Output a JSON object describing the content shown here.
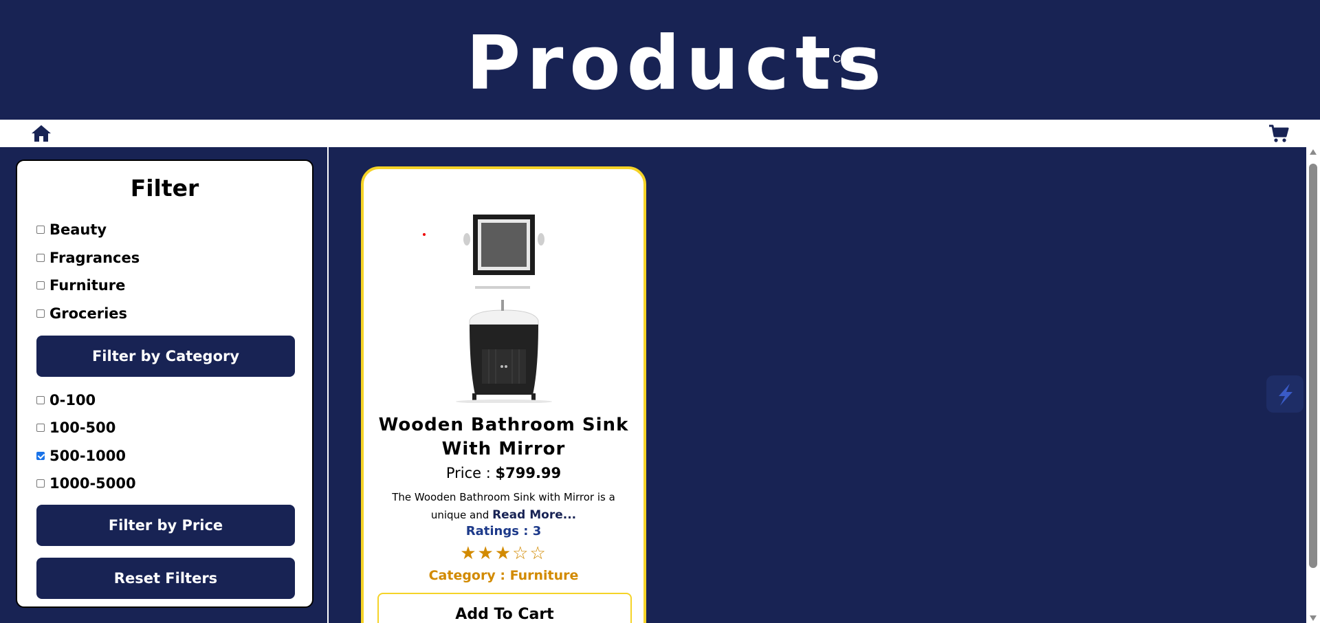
{
  "header": {
    "title": "Products",
    "cart_label": "Cart"
  },
  "navbar": {
    "home_icon": "home-icon",
    "cart_icon": "shopping-cart-icon"
  },
  "filter": {
    "title": "Filter",
    "categories": [
      {
        "label": "Beauty",
        "checked": false
      },
      {
        "label": "Fragrances",
        "checked": false
      },
      {
        "label": "Furniture",
        "checked": false
      },
      {
        "label": "Groceries",
        "checked": false
      }
    ],
    "category_button": "Filter by Category",
    "prices": [
      {
        "label": "0-100",
        "checked": false
      },
      {
        "label": "100-500",
        "checked": false
      },
      {
        "label": "500-1000",
        "checked": true
      },
      {
        "label": "1000-5000",
        "checked": false
      }
    ],
    "price_button": "Filter by Price",
    "reset_button": "Reset Filters"
  },
  "products": [
    {
      "title": "Wooden Bathroom Sink With Mirror",
      "price_label": "Price :",
      "price": "$799.99",
      "description": "The Wooden Bathroom Sink with Mirror is a unique and",
      "read_more": "Read More...",
      "rating_text": "Ratings : 3",
      "rating": 3,
      "rating_max": 5,
      "category_text": "Category : Furniture",
      "add_to_cart": "Add To Cart"
    }
  ],
  "colors": {
    "primary": "#182354",
    "card_border": "#f5d327",
    "star": "#d28a00",
    "rating_text": "#1d3a8a"
  }
}
